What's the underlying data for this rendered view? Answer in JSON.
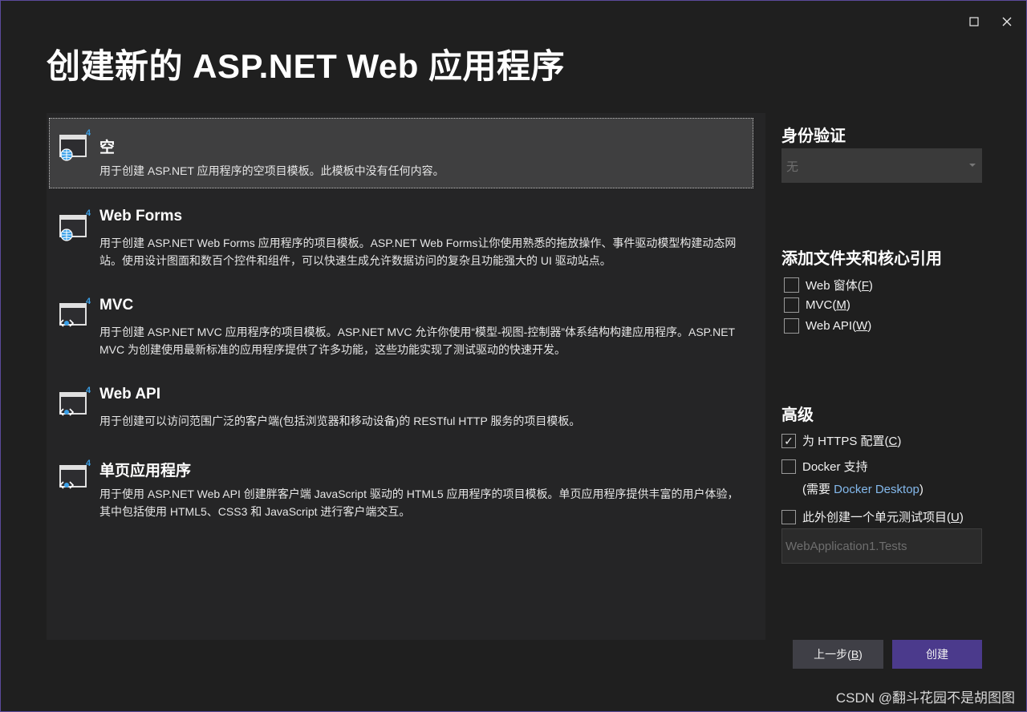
{
  "window": {
    "title": "创建新的 ASP.NET Web 应用程序",
    "maximize_glyph": "☐",
    "close_glyph": "✕"
  },
  "templates": [
    {
      "name": "空",
      "desc": "用于创建 ASP.NET 应用程序的空项目模板。此模板中没有任何内容。",
      "badge": "4",
      "icon": "web-app-globe-icon",
      "selected": true
    },
    {
      "name": "Web Forms",
      "desc": "用于创建 ASP.NET Web Forms 应用程序的项目模板。ASP.NET Web Forms让你使用熟悉的拖放操作、事件驱动模型构建动态网站。使用设计图面和数百个控件和组件，可以快速生成允许数据访问的复杂且功能强大的 UI 驱动站点。",
      "badge": "4",
      "icon": "web-app-globe-icon",
      "selected": false
    },
    {
      "name": "MVC",
      "desc": "用于创建 ASP.NET MVC 应用程序的项目模板。ASP.NET MVC 允许你使用“模型-视图-控制器”体系结构构建应用程序。ASP.NET MVC 为创建使用最新标准的应用程序提供了许多功能，这些功能实现了测试驱动的快速开发。",
      "badge": "4",
      "icon": "web-app-code-icon",
      "selected": false
    },
    {
      "name": "Web API",
      "desc": "用于创建可以访问范围广泛的客户端(包括浏览器和移动设备)的 RESTful HTTP 服务的项目模板。",
      "badge": "4",
      "icon": "web-app-api-icon",
      "selected": false
    },
    {
      "name": "单页应用程序",
      "desc": "用于使用 ASP.NET Web API 创建胖客户端 JavaScript 驱动的 HTML5 应用程序的项目模板。单页应用程序提供丰富的用户体验，其中包括使用 HTML5、CSS3 和 JavaScript 进行客户端交互。",
      "badge": "4",
      "icon": "web-app-code-icon",
      "selected": false
    }
  ],
  "auth": {
    "heading": "身份验证",
    "value": "无"
  },
  "folders": {
    "heading": "添加文件夹和核心引用",
    "items": [
      {
        "label": "Web 窗体(",
        "key": "F",
        "suffix": ")",
        "checked": false
      },
      {
        "label": "MVC(",
        "key": "M",
        "suffix": ")",
        "checked": false
      },
      {
        "label": "Web API(",
        "key": "W",
        "suffix": ")",
        "checked": false
      }
    ]
  },
  "advanced": {
    "heading": "高级",
    "https": {
      "label": "为 HTTPS 配置(",
      "key": "C",
      "suffix": ")",
      "checked": true
    },
    "docker": {
      "label": "Docker 支持",
      "checked": false
    },
    "docker_note_pre": "(需要 ",
    "docker_note_link": "Docker Desktop",
    "docker_note_post": ")",
    "unit_test": {
      "label": "此外创建一个单元测试项目(",
      "key": "U",
      "suffix": ")",
      "checked": false
    },
    "test_project_name": "WebApplication1.Tests"
  },
  "buttons": {
    "back_label": "上一步(",
    "back_key": "B",
    "back_suffix": ")",
    "create_label": "创建"
  },
  "watermark": "CSDN @翻斗花园不是胡图图",
  "check_glyph": "✓",
  "colors": {
    "accent": "#4b3a8c",
    "link": "#84b9ec",
    "badge": "#3aa0e8"
  }
}
